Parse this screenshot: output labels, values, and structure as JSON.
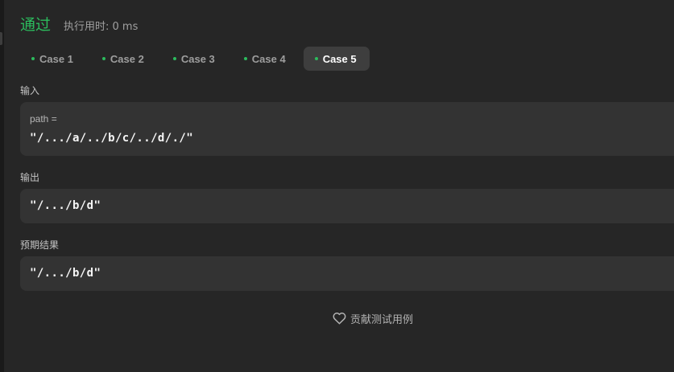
{
  "header": {
    "status": "通过",
    "runtime": "执行用时: 0 ms"
  },
  "tabs": [
    {
      "label": "Case 1",
      "active": false
    },
    {
      "label": "Case 2",
      "active": false
    },
    {
      "label": "Case 3",
      "active": false
    },
    {
      "label": "Case 4",
      "active": false
    },
    {
      "label": "Case 5",
      "active": true
    }
  ],
  "input": {
    "label": "输入",
    "var_name": "path =",
    "value": "\"/.../a/../b/c/../d/./\""
  },
  "output": {
    "label": "输出",
    "value": "\"/.../b/d\""
  },
  "expected": {
    "label": "预期结果",
    "value": "\"/.../b/d\""
  },
  "contribute": {
    "label": "贡献测试用例",
    "icon": "heart-icon"
  },
  "colors": {
    "accepted_green": "#2cbb5d",
    "panel_bg": "#262626",
    "box_bg": "#333333",
    "active_tab_bg": "#3e3e3e"
  }
}
